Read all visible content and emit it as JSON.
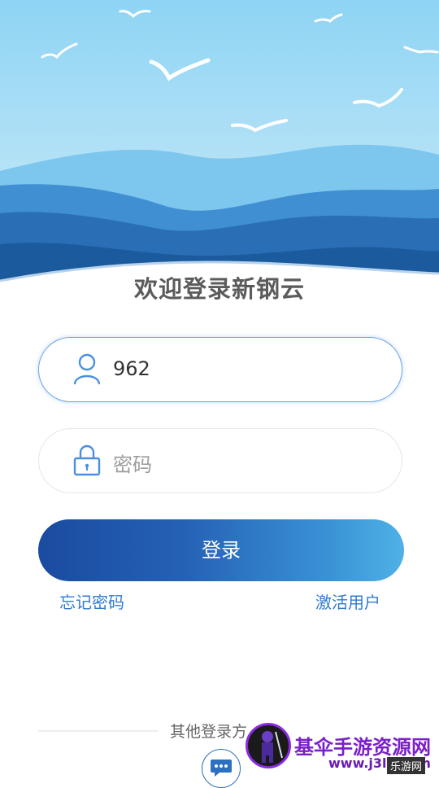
{
  "header": {
    "title": "欢迎登录新钢云"
  },
  "username": {
    "value": "962"
  },
  "password": {
    "placeholder": "密码"
  },
  "login": {
    "label": "登录"
  },
  "links": {
    "forgot": "忘记密码",
    "activate": "激活用户"
  },
  "other_login": {
    "label": "其他登录方"
  },
  "watermark": {
    "title": "基伞手游资源网",
    "url": "www.j3l3.com",
    "tag": "乐游网"
  },
  "colors": {
    "accent": "#2f7bd0",
    "gradient_start": "#1a4ba0",
    "gradient_end": "#4fb1e6",
    "sea_dark": "#1c5a9e",
    "sky": "#8fd3f3"
  },
  "icons": {
    "user": "user-icon",
    "lock": "lock-icon",
    "message": "chat-bubble-icon"
  }
}
